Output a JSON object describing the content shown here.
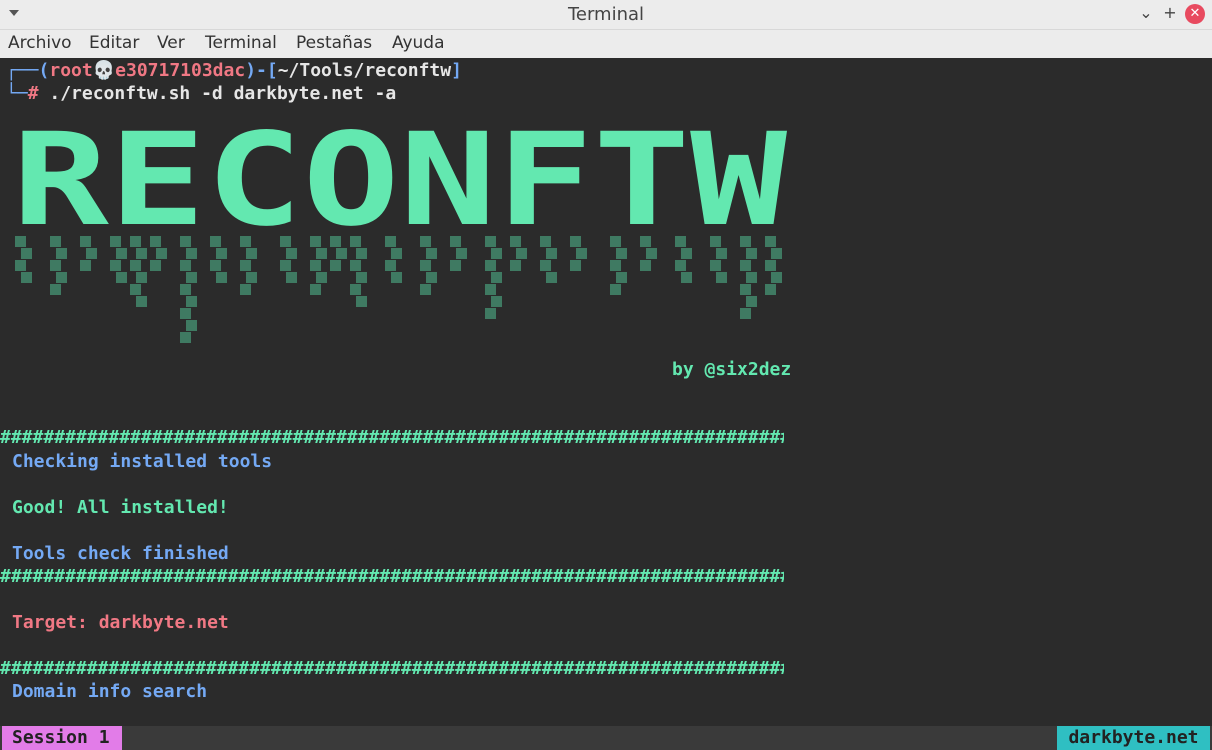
{
  "window": {
    "title": "Terminal"
  },
  "menu": [
    "Archivo",
    "Editar",
    "Ver",
    "Terminal",
    "Pestañas",
    "Ayuda"
  ],
  "prompt": {
    "open": "┌──(",
    "user": "root",
    "skull": "💀",
    "host": "e30717103dac",
    "mid": ")-[",
    "path": "~/Tools/reconftw",
    "close": "]",
    "corner": "└─",
    "hash": "#",
    "command": " ./reconftw.sh -d darkbyte.net -a"
  },
  "banner": {
    "text": "RECONFTW",
    "author": "by @six2dez"
  },
  "output": {
    "separator": "#####################################################################################",
    "checking": "Checking installed tools",
    "good": "Good! All installed!",
    "finished": "Tools check finished",
    "target_label": "Target: darkbyte.net",
    "domain_info": "Domain info search"
  },
  "status": {
    "session": "Session 1",
    "host": "darkbyte.net"
  },
  "colors": {
    "accent_mint": "#63e8b0",
    "accent_blue": "#74a9f4",
    "accent_pink": "#f07884",
    "session_bg": "#e27ce8",
    "host_bg": "#2fbfc2"
  }
}
